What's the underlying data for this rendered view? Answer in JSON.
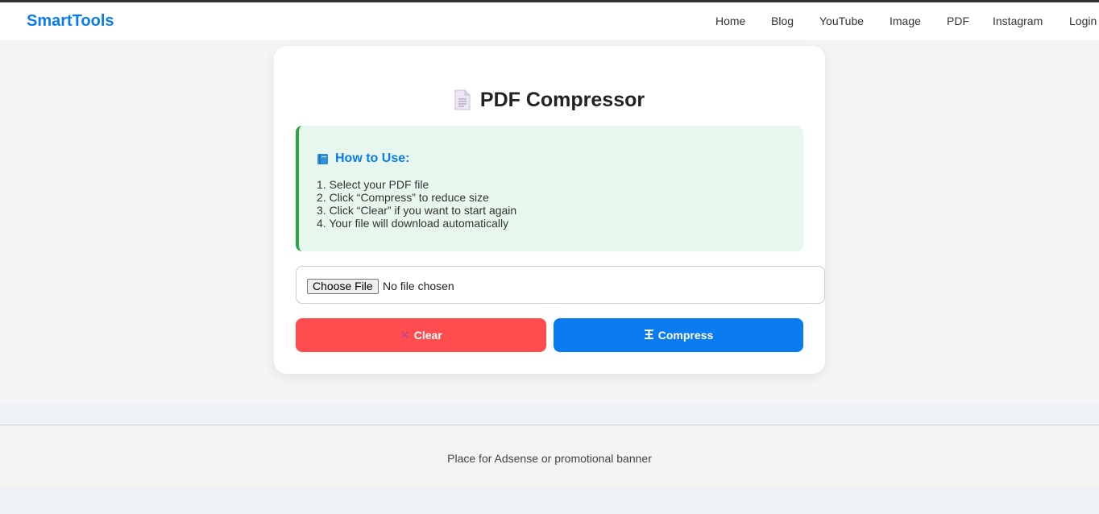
{
  "header": {
    "brand": "SmartTools",
    "nav": [
      "Home",
      "Blog",
      "YouTube",
      "Image",
      "PDF",
      "Instagram",
      "Login"
    ]
  },
  "card": {
    "title": "PDF Compressor",
    "how_to": {
      "heading": "How to Use:",
      "steps": [
        "1. Select your PDF file",
        "2. Click “Compress” to reduce size",
        "3. Click “Clear” if you want to start again",
        "4. Your file will download automatically"
      ]
    },
    "file_input": {
      "button_label": "Choose File",
      "status": "No file chosen"
    },
    "buttons": {
      "clear_label": "Clear",
      "compress_label": "Compress"
    }
  },
  "ad": {
    "text": "Place for Adsense or promotional banner"
  },
  "colors": {
    "brand": "#0a7cf0",
    "clear_button": "#ff4d4f",
    "compress_button": "#0a7cf0",
    "howto_bg": "#e8f7ee",
    "howto_border": "#28a745"
  },
  "icons": {
    "title": "document-icon",
    "how_to": "book-icon",
    "clear": "cross-icon",
    "compress": "clamp-icon"
  }
}
